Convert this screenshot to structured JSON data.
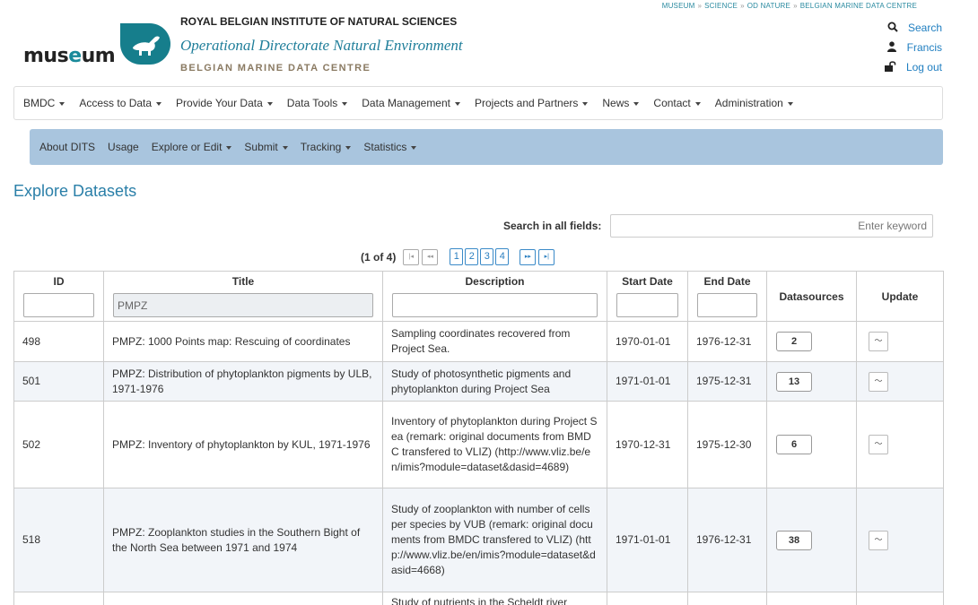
{
  "breadcrumb": [
    "MUSEUM",
    "SCIENCE",
    "OD NATURE",
    "BELGIAN MARINE DATA CENTRE"
  ],
  "logo": {
    "text_prefix": "mus",
    "text_e": "e",
    "text_suffix": "um"
  },
  "header": {
    "institute": "ROYAL BELGIAN INSTITUTE OF NATURAL SCIENCES",
    "directorate": "Operational Directorate Natural Environment",
    "centre": "BELGIAN MARINE DATA CENTRE"
  },
  "user_links": {
    "search": "Search",
    "user": "Francis",
    "logout": "Log out"
  },
  "main_nav": [
    "BMDC",
    "Access to Data",
    "Provide Your Data",
    "Data Tools",
    "Data Management",
    "Projects and Partners",
    "News",
    "Contact",
    "Administration"
  ],
  "sub_nav": [
    {
      "label": "About DITS",
      "dropdown": false
    },
    {
      "label": "Usage",
      "dropdown": false
    },
    {
      "label": "Explore or Edit",
      "dropdown": true
    },
    {
      "label": "Submit",
      "dropdown": true
    },
    {
      "label": "Tracking",
      "dropdown": true
    },
    {
      "label": "Statistics",
      "dropdown": true
    }
  ],
  "page_title": "Explore Datasets",
  "search": {
    "label": "Search in all fields:",
    "placeholder": "Enter keyword",
    "value": ""
  },
  "pager": {
    "info": "(1 of 4)",
    "first": "|◂",
    "prev": "◂◂",
    "pages": [
      "1",
      "2",
      "3",
      "4"
    ],
    "next": "▸▸",
    "last": "▸|"
  },
  "table": {
    "columns": [
      "ID",
      "Title",
      "Description",
      "Start Date",
      "End Date",
      "Datasources",
      "Update"
    ],
    "filters": {
      "id": "",
      "title": "PMPZ",
      "description": "",
      "start": "",
      "end": ""
    },
    "rows": [
      {
        "id": "498",
        "title": "PMPZ: 1000 Points map: Rescuing of coordinates",
        "description": "Sampling coordinates recovered from Project Sea.",
        "start": "1970-01-01",
        "end": "1976-12-31",
        "datasources": "2"
      },
      {
        "id": "501",
        "title": "PMPZ: Distribution of phytoplankton pigments by ULB, 1971-1976",
        "description": "Study of photosynthetic pigments and phytoplankton during Project Sea",
        "start": "1971-01-01",
        "end": "1975-12-31",
        "datasources": "13"
      },
      {
        "id": "502",
        "title": "PMPZ: Inventory of phytoplankton by KUL, 1971-1976",
        "description": "Inventory of phytoplankton during Project Sea (remark: original documents from BMDC transfered to VLIZ) (http://www.vliz.be/en/imis?module=dataset&dasid=4689)",
        "start": "1970-12-31",
        "end": "1975-12-30",
        "datasources": "6"
      },
      {
        "id": "518",
        "title": "PMPZ: Zooplankton studies in the Southern Bight of the North Sea between 1971 and 1974",
        "description": "Study of zooplankton with number of cells per species by VUB (remark: original documents from BMDC transfered to VLIZ) (http://www.vliz.be/en/imis?module=dataset&dasid=4668)",
        "start": "1971-01-01",
        "end": "1976-12-31",
        "datasources": "38"
      },
      {
        "id": "",
        "title": "",
        "description": "Study of nutrients in the Scheldt river",
        "start": "",
        "end": "",
        "datasources": ""
      }
    ]
  },
  "colors": {
    "accent": "#1f7ec0",
    "subnav_bg": "#a9c5de",
    "title": "#2a7fa8",
    "logo": "#167e8c"
  }
}
